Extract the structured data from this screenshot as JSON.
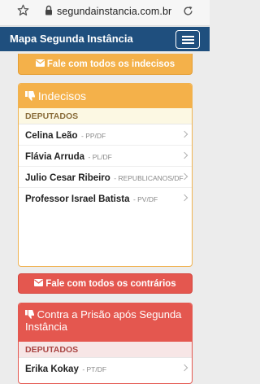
{
  "browser": {
    "url": "segundainstancia.com.br",
    "star_icon": "star-outline-icon",
    "lock_icon": "lock-icon",
    "reload_icon": "reload-icon"
  },
  "navbar": {
    "brand": "Mapa Segunda Instância",
    "menu_icon": "hamburger-menu-icon",
    "color": "#1f4f7e"
  },
  "contact_undecided": {
    "label": "Fale com todos os indecisos",
    "icon": "envelope-icon",
    "color": "#f4b14a"
  },
  "undecided_panel": {
    "title": "Indecisos",
    "icon": "thumbs-down-icon",
    "section_label": "DEPUTADOS",
    "deputies": [
      {
        "name": "Celina Leão",
        "party": "- PP/DF"
      },
      {
        "name": "Flávia Arruda",
        "party": "- PL/DF"
      },
      {
        "name": "Julio Cesar Ribeiro",
        "party": "- REPUBLICANOS/DF"
      },
      {
        "name": "Professor Israel Batista",
        "party": "- PV/DF"
      }
    ]
  },
  "contact_against": {
    "label": "Fale com todos os contrários",
    "icon": "envelope-icon",
    "color": "#e4574f"
  },
  "against_panel": {
    "title": "Contra a Prisão após Segunda Instância",
    "icon": "thumbs-down-icon",
    "section_label": "DEPUTADOS",
    "deputies": [
      {
        "name": "Erika Kokay",
        "party": "- PT/DF"
      }
    ]
  }
}
